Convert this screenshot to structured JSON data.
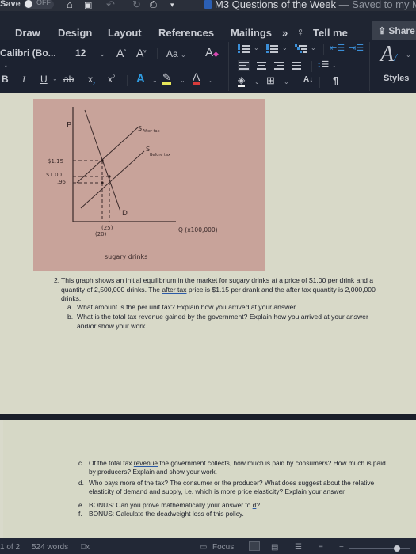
{
  "titlebar": {
    "autosave_label": "Save",
    "autosave_state": "OFF",
    "doc_title": "M3 Questions of the Week",
    "save_status": "— Saved to my Ma"
  },
  "ribbon_tabs": {
    "tabs": [
      "Draw",
      "Design",
      "Layout",
      "References",
      "Mailings"
    ],
    "more": "»",
    "tell_me": "Tell me",
    "share": "Share"
  },
  "ribbon": {
    "font_name": "Calibri (Bo...",
    "font_size": "12",
    "grow_font": "A",
    "shrink_font": "A",
    "change_case": "Aa",
    "bold": "B",
    "italic": "I",
    "underline": "U",
    "strikethrough": "ab",
    "subscript": "x",
    "superscript": "x",
    "text_effects": "A",
    "font_color": "A",
    "styles_label": "Styles",
    "sort_label": "A↓",
    "pilcrow": "¶",
    "colors": {
      "highlight": "#e6e65a",
      "font_color": "#d83b3b",
      "text_effects": "#2f9be0",
      "clear_format": "#d84ab2"
    }
  },
  "document": {
    "graph": {
      "y_axis_label": "P",
      "x_axis_label": "Q (x100,000)",
      "caption": "sugary drinks",
      "price_labels": [
        "$1.15",
        "$1.00",
        ".95"
      ],
      "quantity_labels": [
        "(25)",
        "(20)"
      ],
      "curve_labels": {
        "s_after": "S",
        "s_after_sub": "After tax",
        "s_before": "S",
        "s_before_sub": "Before tax",
        "demand": "D"
      }
    },
    "question_number": "2.",
    "question_text_1": "This graph shows an initial equilibrium in the market for sugary drinks at a price of $1.00 per drink and a quantity of 2,500,000 drinks. The ",
    "question_underlined": "after tax",
    "question_text_2": " price is $1.15 per drank and the after tax quantity is 2,000,000 drinks.",
    "parts": [
      {
        "letter": "a.",
        "text": "What amount is the per unit tax? Explain how you arrived at your answer."
      },
      {
        "letter": "b.",
        "text": "What is the total tax revenue gained by the government? Explain how you arrived at your answer and/or show your work."
      }
    ],
    "parts_page2": [
      {
        "letter": "c.",
        "pre": "Of the total tax ",
        "underlined": "revenue",
        "post": " the government collects, how much is paid by consumers? How much is paid by producers? Explain and show your work."
      },
      {
        "letter": "d.",
        "pre": "Who pays more of the tax? The consumer or the producer? What does suggest about the relative elasticity of demand and supply, i.e. which is more price elasticity? Explain your answer.",
        "underlined": "",
        "post": ""
      },
      {
        "letter": "e.",
        "pre": "BONUS: Can you prove mathematically your answer to ",
        "underlined": "d",
        "post": "?"
      },
      {
        "letter": "f.",
        "pre": "BONUS: Calculate the deadweight loss of this policy.",
        "underlined": "",
        "post": ""
      }
    ]
  },
  "statusbar": {
    "page": "1 of 2",
    "words": "524 words",
    "focus": "Focus",
    "zoom_fraction": 0.78
  }
}
